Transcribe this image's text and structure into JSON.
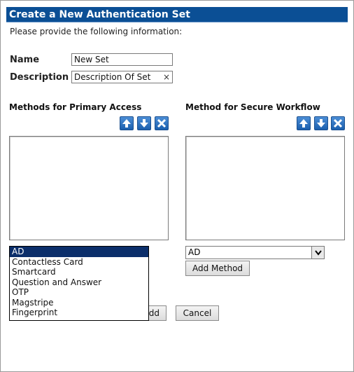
{
  "dialog": {
    "title": "Create a New Authentication Set",
    "instructions": "Please provide the following information:"
  },
  "form": {
    "name_label": "Name",
    "name_value": "New Set",
    "description_label": "Description",
    "description_value": "Description Of Set",
    "clear_glyph": "×"
  },
  "primary": {
    "label": "Methods for Primary Access",
    "selected": "AD",
    "options": [
      "AD",
      "Contactless Card",
      "Smartcard",
      "Question and Answer",
      "OTP",
      "Magstripe",
      "Fingerprint"
    ]
  },
  "secure": {
    "label": "Method for Secure Workflow",
    "selected": "AD",
    "add_button": "Add Method"
  },
  "toolbar_icons": [
    "up-arrow-icon",
    "down-arrow-icon",
    "delete-x-icon"
  ],
  "footer": {
    "add_button_partial": "dd",
    "cancel_button": "Cancel"
  },
  "colors": {
    "title_bar": "#0b4f95",
    "selected_option": "#0b2e6a",
    "icon_blue": "#1b5fae"
  }
}
